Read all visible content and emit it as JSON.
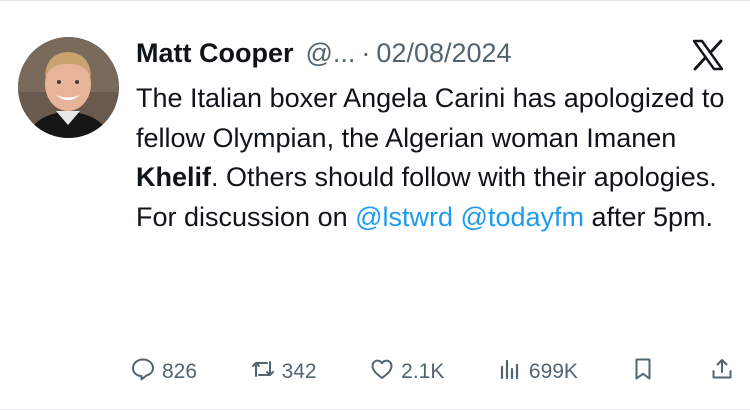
{
  "tweet": {
    "author_name": "Matt Cooper",
    "handle": "@...",
    "separator": "·",
    "date": "02/08/2024",
    "text": {
      "part1": "The Italian boxer Angela Carini has apologized to fellow Olympian, the Algerian woman Imanen ",
      "bold": "Khelif",
      "part2": ". Others should follow with their apologies. For discussion on ",
      "mention1": "@lstwrd",
      "space": " ",
      "mention2": "@todayfm",
      "part3": " after 5pm."
    }
  },
  "actions": {
    "replies": "826",
    "reposts": "342",
    "likes": "2.1K",
    "views": "699K"
  },
  "icons": {
    "platform_logo": "x-logo-icon",
    "reply": "speech-bubble-icon",
    "repost": "repost-arrows-icon",
    "like": "heart-icon",
    "views": "bar-chart-icon",
    "bookmark": "bookmark-icon",
    "share": "share-upload-icon"
  },
  "colors": {
    "text": "#0f1419",
    "secondary": "#536471",
    "link": "#1d9bf0",
    "background": "#ffffff"
  }
}
